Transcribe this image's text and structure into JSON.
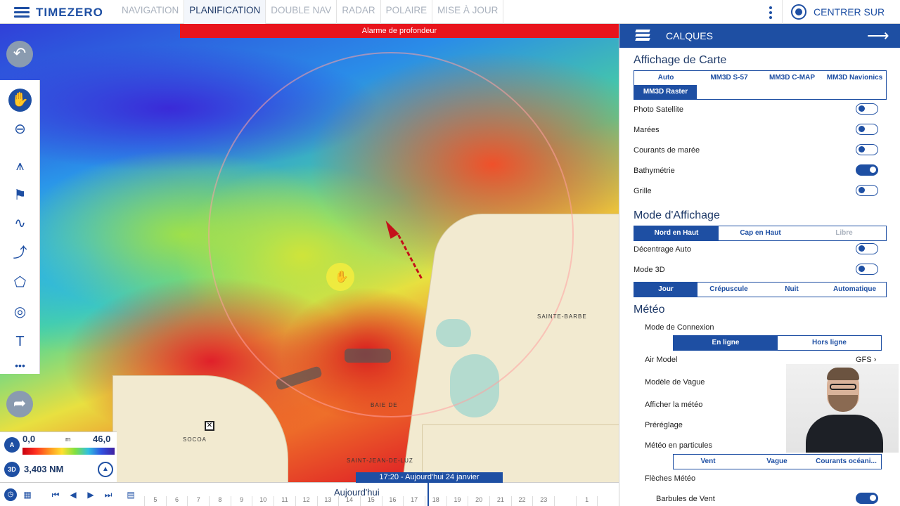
{
  "app": {
    "brand": "TIMEZERO"
  },
  "topbar": {
    "tabs": [
      "NAVIGATION",
      "PLANIFICATION",
      "DOUBLE NAV",
      "RADAR",
      "POLAIRE",
      "MISE À JOUR"
    ],
    "active_tab": "PLANIFICATION",
    "center_label": "CENTRER SUR"
  },
  "map": {
    "alarm": "Alarme de profondeur",
    "labels": {
      "sainte_barbe": "SAINTE-BARBE",
      "baie": "BAIE DE",
      "saint_jean": "SAINT-JEAN-DE-LUZ",
      "socoa": "SOCOA"
    }
  },
  "depth_scale": {
    "badge": "A",
    "min": "0,0",
    "unit": "m",
    "max": "46,0",
    "mode": "3D",
    "distance": "3,403 NM"
  },
  "timeline": {
    "today": "Aujourd'hui",
    "current": "17:20 - Aujourd'hui 24 janvier",
    "ticks": [
      "5",
      "6",
      "7",
      "8",
      "9",
      "10",
      "11",
      "12",
      "13",
      "14",
      "15",
      "16",
      "17",
      "18",
      "19",
      "20",
      "21",
      "22",
      "23",
      "",
      "1",
      ""
    ]
  },
  "panel": {
    "title": "CALQUES",
    "affichage_carte": {
      "title": "Affichage de Carte",
      "options": [
        "Auto",
        "MM3D S-57",
        "MM3D C-MAP",
        "MM3D Navionics",
        "MM3D Raster"
      ],
      "selected": "MM3D Raster"
    },
    "toggles": [
      {
        "label": "Photo Satellite",
        "on": false
      },
      {
        "label": "Marées",
        "on": false
      },
      {
        "label": "Courants de marée",
        "on": false
      },
      {
        "label": "Bathymétrie",
        "on": true
      },
      {
        "label": "Grille",
        "on": false
      }
    ],
    "mode_affichage": {
      "title": "Mode d'Affichage",
      "options": [
        "Nord en Haut",
        "Cap en Haut",
        "Libre"
      ],
      "selected": "Nord en Haut",
      "decentrage": {
        "label": "Décentrage Auto",
        "on": false
      },
      "mode3d": {
        "label": "Mode 3D",
        "on": false
      },
      "palette": [
        "Jour",
        "Crépuscule",
        "Nuit",
        "Automatique"
      ],
      "palette_selected": "Jour"
    },
    "meteo": {
      "title": "Météo",
      "connexion_label": "Mode de Connexion",
      "connexion_options": [
        "En ligne",
        "Hors ligne"
      ],
      "connexion_selected": "En ligne",
      "air_model_label": "Air Model",
      "air_model_value": "GFS",
      "wave_model_label": "Modèle de Vague",
      "show_label": "Afficher la météo",
      "preset_label": "Préréglage",
      "particles_label": "Météo en particules",
      "particles_options": [
        "Vent",
        "Vague",
        "Courants océani..."
      ],
      "arrows_label": "Flèches Météo",
      "barbs_label": "Barbules de Vent",
      "barbs_on": true
    }
  },
  "icons": [
    "hamburger-icon",
    "kebab-icon",
    "target-icon",
    "back-icon",
    "hand-icon",
    "zoom-out-icon",
    "compass-icon",
    "buoy-icon",
    "route-icon",
    "waypoint-icon",
    "polygon-icon",
    "target-tool-icon",
    "text-icon",
    "more-icon",
    "forward-icon",
    "layers-icon",
    "arrow-right-icon",
    "clock-icon",
    "calendar-icon"
  ]
}
